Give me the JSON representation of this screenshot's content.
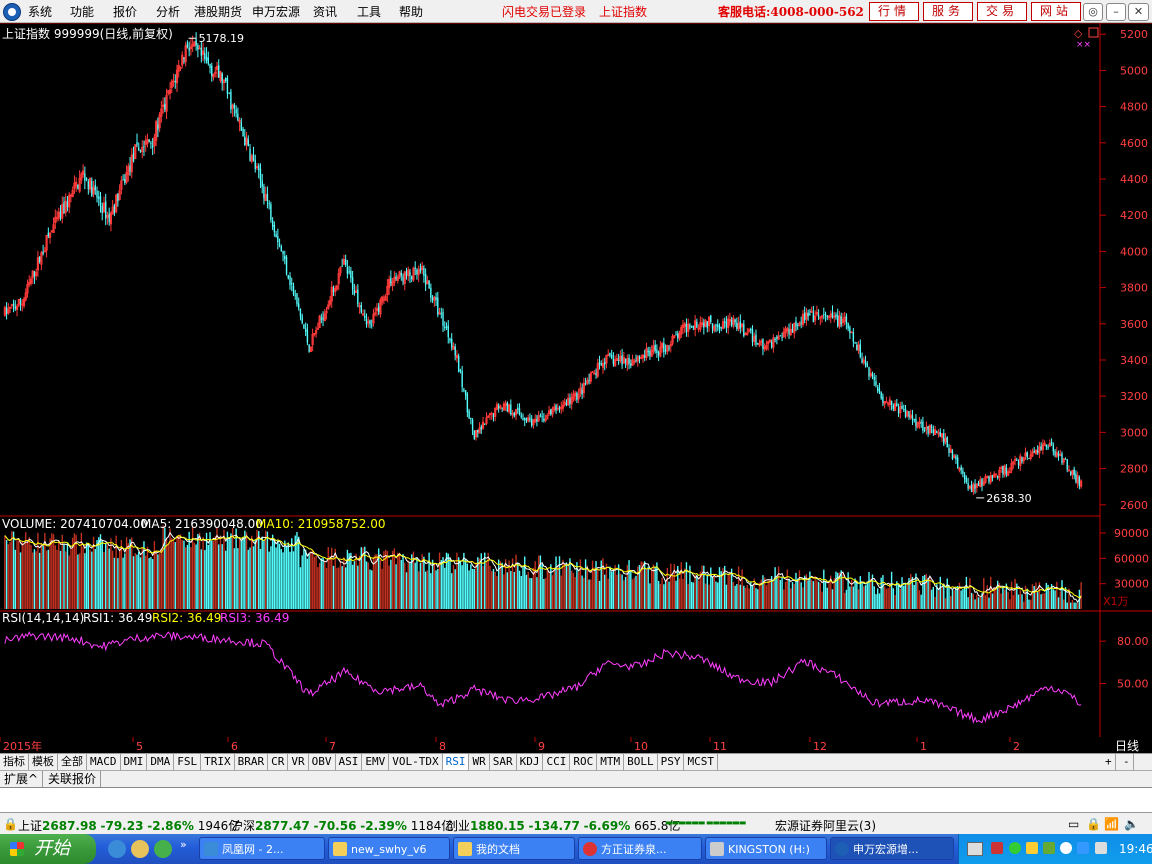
{
  "menubar": {
    "items": [
      "系统",
      "功能",
      "报价",
      "分析",
      "港股期货",
      "申万宏源",
      "资讯",
      "工具",
      "帮助"
    ],
    "status_login": "闪电交易已登录",
    "status_index": "上证指数",
    "phone": "客服电话:4008-000-562",
    "nav_buttons": [
      "行情",
      "服务",
      "交易",
      "网站"
    ]
  },
  "chart_header": {
    "title": "上证指数 999999(日线,前复权)"
  },
  "volume_header": {
    "volume": "VOLUME: 207410704.00",
    "ma5": "MA5: 216390048.00",
    "ma10": "MA10: 210958752.00",
    "unit": "X1万"
  },
  "rsi_header": {
    "name": "RSI(14,14,14)",
    "rsi1": "RSI1: 36.49",
    "rsi2": "RSI2: 36.49",
    "rsi3": "RSI3: 36.49"
  },
  "colors": {
    "up": "#ff3a3a",
    "down": "#54ffff",
    "ma5": "#ffffff",
    "ma10": "#ffff00",
    "rsi": "#ff40ff",
    "axis": "#c00000"
  },
  "chart_data": {
    "type": "candlestick",
    "price_axis": {
      "ticks": [
        2600,
        2800,
        3000,
        3200,
        3400,
        3600,
        3800,
        4000,
        4200,
        4400,
        4600,
        4800,
        5000,
        5200
      ],
      "range": [
        2560,
        5240
      ]
    },
    "high_marker": "5178.19",
    "low_marker": "2638.30",
    "anchors": [
      [
        0,
        3660
      ],
      [
        10,
        3720
      ],
      [
        25,
        4080
      ],
      [
        45,
        4430
      ],
      [
        60,
        4180
      ],
      [
        75,
        4550
      ],
      [
        85,
        4620
      ],
      [
        105,
        5150
      ],
      [
        125,
        4950
      ],
      [
        150,
        4310
      ],
      [
        175,
        3470
      ],
      [
        195,
        3930
      ],
      [
        210,
        3580
      ],
      [
        222,
        3850
      ],
      [
        240,
        3880
      ],
      [
        258,
        3480
      ],
      [
        270,
        2970
      ],
      [
        285,
        3160
      ],
      [
        305,
        3050
      ],
      [
        330,
        3210
      ],
      [
        345,
        3400
      ],
      [
        360,
        3400
      ],
      [
        380,
        3470
      ],
      [
        395,
        3610
      ],
      [
        420,
        3600
      ],
      [
        437,
        3470
      ],
      [
        460,
        3640
      ],
      [
        482,
        3620
      ],
      [
        505,
        3190
      ],
      [
        540,
        2960
      ],
      [
        555,
        2690
      ],
      [
        575,
        2790
      ],
      [
        600,
        2940
      ],
      [
        610,
        2830
      ],
      [
        620,
        2700
      ]
    ],
    "volume_axis": {
      "ticks": [
        "30000",
        "60000",
        "90000"
      ]
    },
    "rsi_axis": {
      "ticks": [
        "50.00",
        "80.00"
      ]
    },
    "rsi_anchors": [
      [
        0,
        80
      ],
      [
        15,
        84
      ],
      [
        40,
        82
      ],
      [
        55,
        76
      ],
      [
        75,
        82
      ],
      [
        90,
        84
      ],
      [
        120,
        82
      ],
      [
        150,
        78
      ],
      [
        175,
        42
      ],
      [
        195,
        58
      ],
      [
        215,
        45
      ],
      [
        240,
        48
      ],
      [
        250,
        34
      ],
      [
        270,
        46
      ],
      [
        290,
        38
      ],
      [
        310,
        40
      ],
      [
        330,
        48
      ],
      [
        345,
        64
      ],
      [
        365,
        62
      ],
      [
        380,
        72
      ],
      [
        400,
        68
      ],
      [
        420,
        54
      ],
      [
        440,
        50
      ],
      [
        460,
        66
      ],
      [
        480,
        54
      ],
      [
        500,
        36
      ],
      [
        530,
        38
      ],
      [
        560,
        24
      ],
      [
        580,
        34
      ],
      [
        600,
        48
      ],
      [
        610,
        44
      ],
      [
        618,
        36
      ]
    ],
    "month_labels": [
      "2015年",
      "5",
      "6",
      "7",
      "8",
      "9",
      "10",
      "11",
      "12",
      "1",
      "2"
    ],
    "period": "日线"
  },
  "indicator_tabs": [
    "指标",
    "模板",
    "全部",
    "MACD",
    "DMI",
    "DMA",
    "FSL",
    "TRIX",
    "BRAR",
    "CR",
    "VR",
    "OBV",
    "ASI",
    "EMV",
    "VOL-TDX",
    "RSI",
    "WR",
    "SAR",
    "KDJ",
    "CCI",
    "ROC",
    "MTM",
    "BOLL",
    "PSY",
    "MCST"
  ],
  "active_tab": "RSI",
  "ext_tabs": [
    "扩展^",
    "关联报价"
  ],
  "ticker": {
    "sh_label": "上证",
    "sh_val": "2687.98",
    "sh_chg": "-79.23",
    "sh_pct": "-2.86%",
    "sh_amt": "1946亿",
    "hs_label": "沪深",
    "hs_val": "2877.47",
    "hs_chg": "-70.56",
    "hs_pct": "-2.39%",
    "hs_amt": "1184亿",
    "cy_label": "创业",
    "cy_val": "1880.15",
    "cy_chg": "-134.77",
    "cy_pct": "-6.69%",
    "cy_amt": "665.8亿",
    "broker": "宏源证券阿里云(3)"
  },
  "taskbar": {
    "start": "开始",
    "items": [
      "凤凰网 - 2...",
      "new_swhy_v6",
      "我的文档",
      "方正证券泉...",
      "KINGSTON (H:)",
      "申万宏源增..."
    ],
    "clock": "19:46"
  }
}
